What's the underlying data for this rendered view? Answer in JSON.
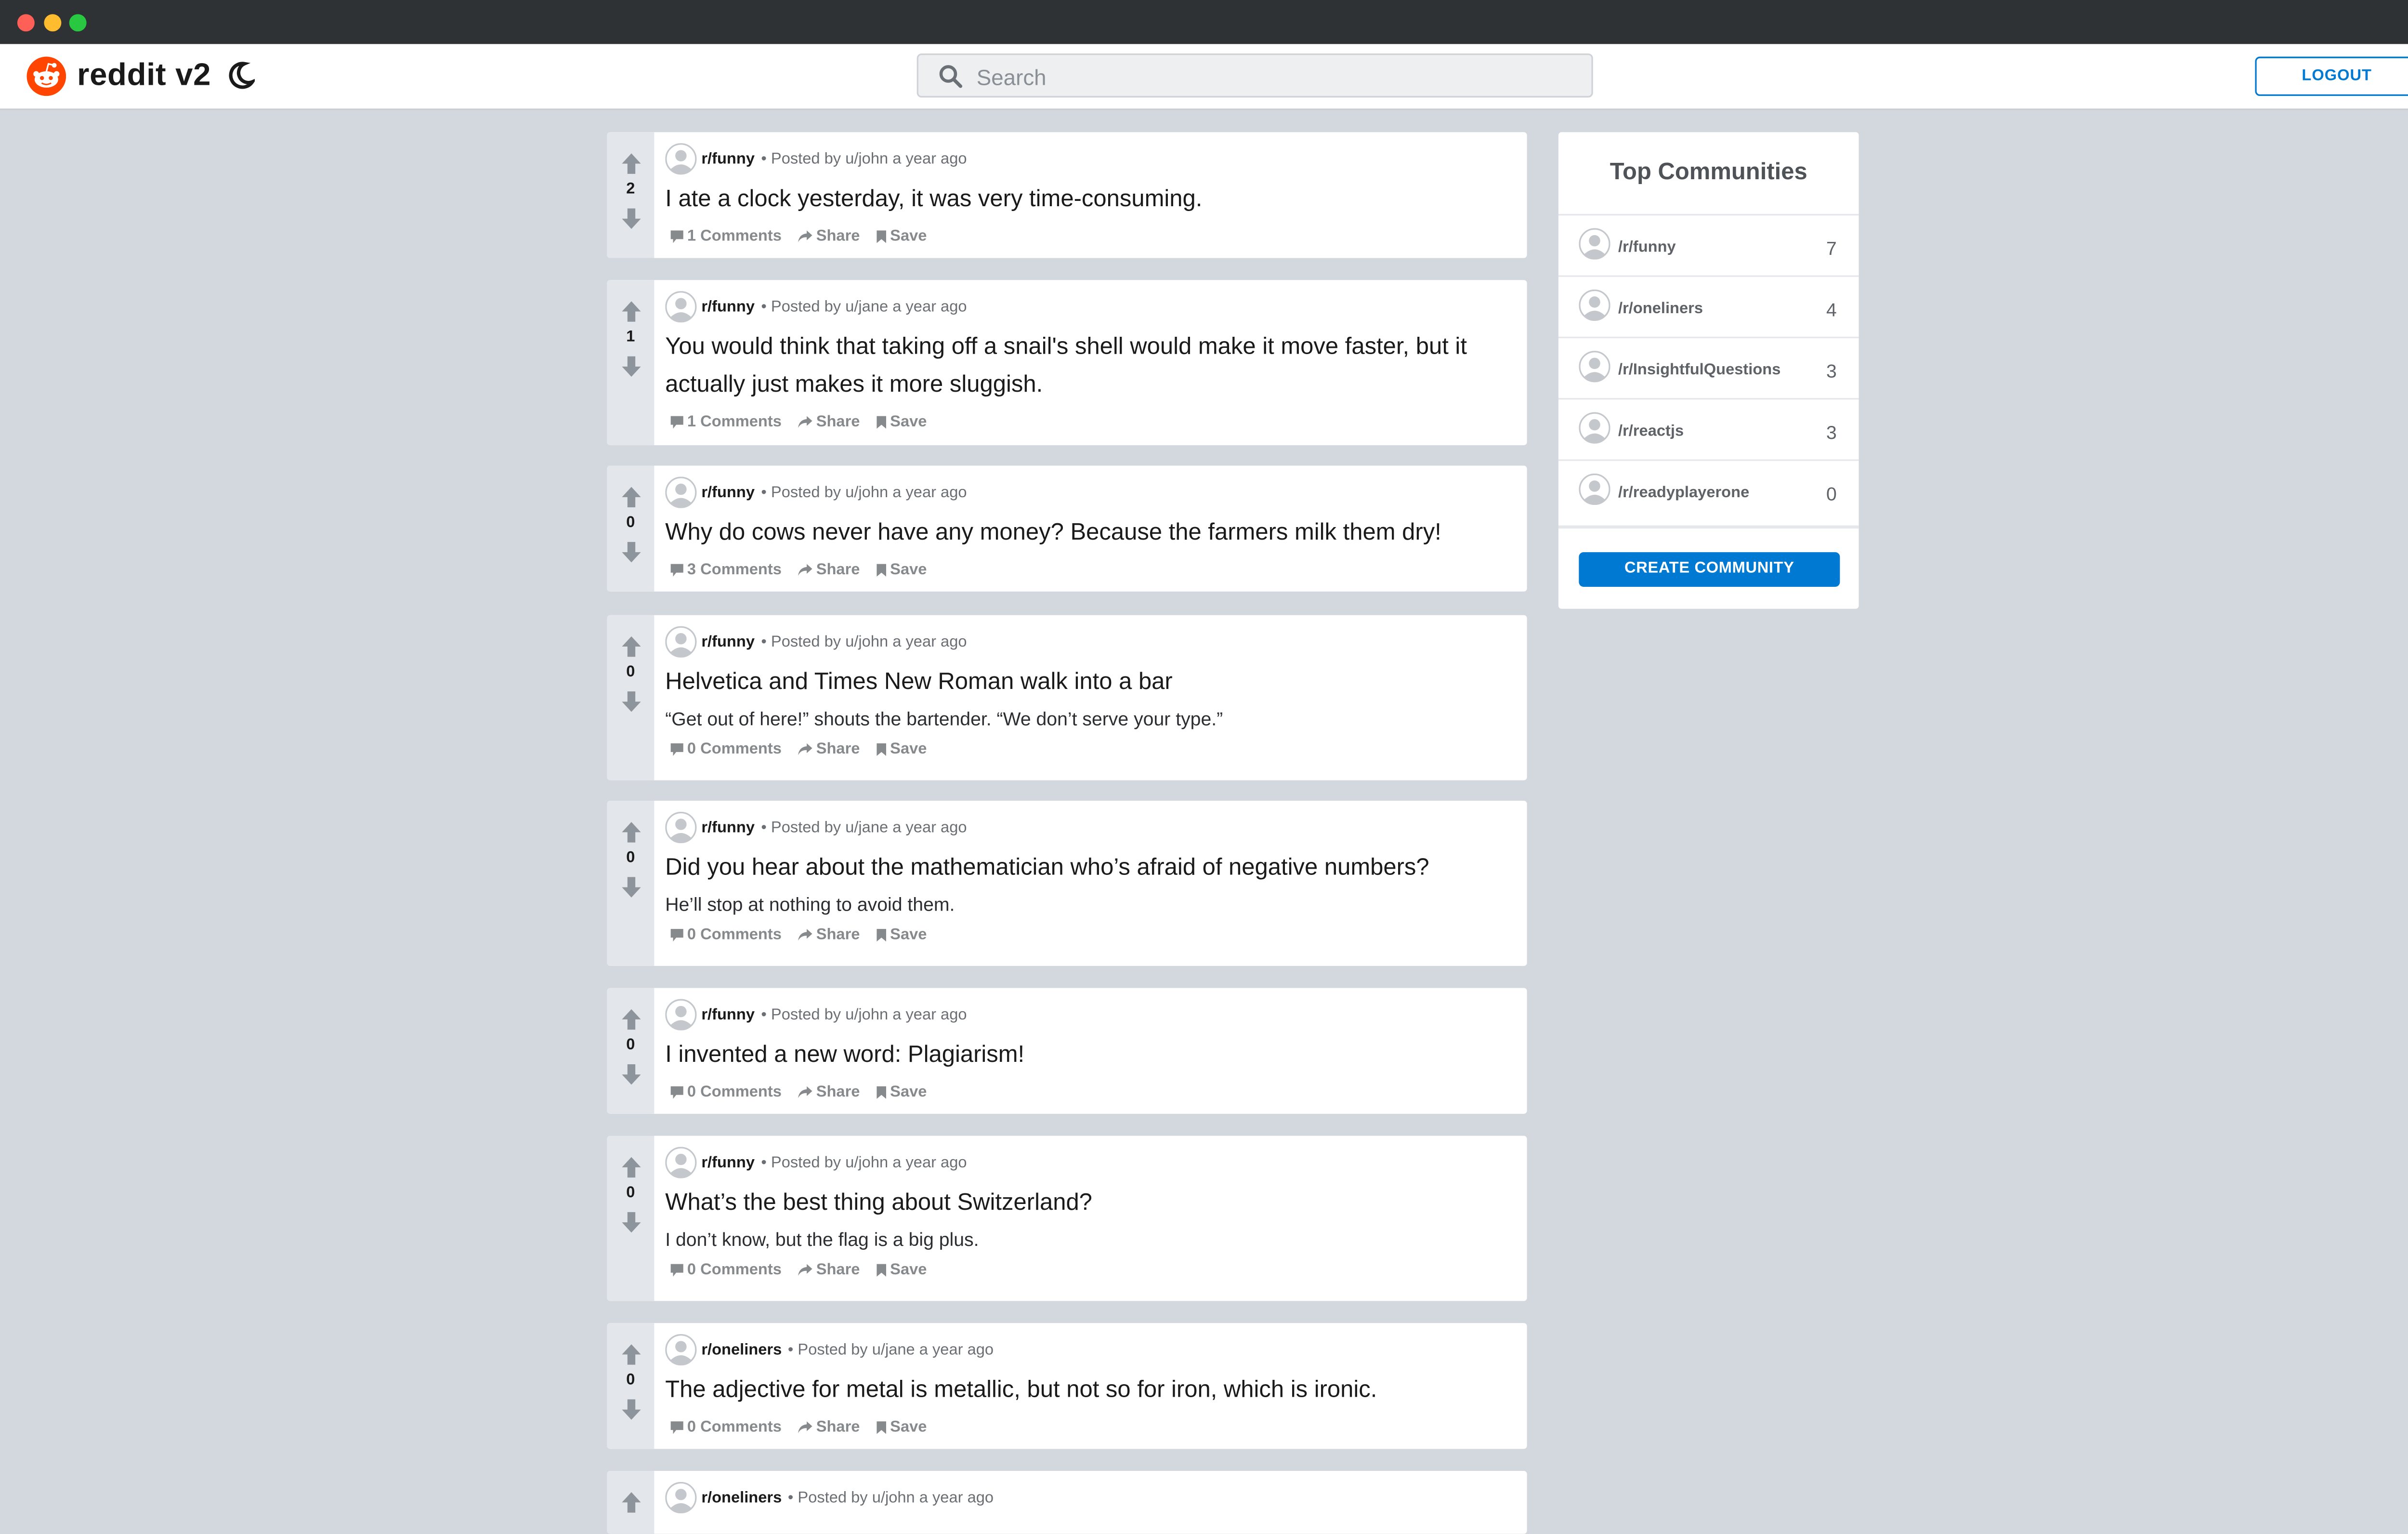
{
  "app": {
    "title": "reddit v2"
  },
  "header": {
    "search_placeholder": "Search",
    "logout_label": "LOGOUT"
  },
  "posts": [
    {
      "community": "r/funny",
      "author_text": "• Posted by u/john a year ago",
      "score": "2",
      "title": "I ate a clock yesterday, it was very time-consuming.",
      "body": "",
      "comments": "1 Comments",
      "share": "Share",
      "save": "Save"
    },
    {
      "community": "r/funny",
      "author_text": "• Posted by u/jane a year ago",
      "score": "1",
      "title": "You would think that taking off a snail's shell would make it move faster, but it actually just makes it more sluggish.",
      "body": "",
      "comments": "1 Comments",
      "share": "Share",
      "save": "Save"
    },
    {
      "community": "r/funny",
      "author_text": "• Posted by u/john a year ago",
      "score": "0",
      "title": "Why do cows never have any money? Because the farmers milk them dry!",
      "body": "",
      "comments": "3 Comments",
      "share": "Share",
      "save": "Save"
    },
    {
      "community": "r/funny",
      "author_text": "• Posted by u/john a year ago",
      "score": "0",
      "title": "Helvetica and Times New Roman walk into a bar",
      "body": "“Get out of here!” shouts the bartender. “We don’t serve your type.”",
      "comments": "0 Comments",
      "share": "Share",
      "save": "Save"
    },
    {
      "community": "r/funny",
      "author_text": "• Posted by u/jane a year ago",
      "score": "0",
      "title": "Did you hear about the mathematician who’s afraid of negative numbers?",
      "body": "He’ll stop at nothing to avoid them.",
      "comments": "0 Comments",
      "share": "Share",
      "save": "Save"
    },
    {
      "community": "r/funny",
      "author_text": "• Posted by u/john a year ago",
      "score": "0",
      "title": "I invented a new word: Plagiarism!",
      "body": "",
      "comments": "0 Comments",
      "share": "Share",
      "save": "Save"
    },
    {
      "community": "r/funny",
      "author_text": "• Posted by u/john a year ago",
      "score": "0",
      "title": "What’s the best thing about Switzerland?",
      "body": "I don’t know, but the flag is a big plus.",
      "comments": "0 Comments",
      "share": "Share",
      "save": "Save"
    },
    {
      "community": "r/oneliners",
      "author_text": "• Posted by u/jane a year ago",
      "score": "0",
      "title": "The adjective for metal is metallic, but not so for iron, which is ironic.",
      "body": "",
      "comments": "0 Comments",
      "share": "Share",
      "save": "Save"
    },
    {
      "community": "r/oneliners",
      "author_text": "• Posted by u/john a year ago",
      "score": "",
      "title": "",
      "body": "",
      "comments": "",
      "share": "",
      "save": ""
    }
  ],
  "sidebar": {
    "title": "Top Communities",
    "communities": [
      {
        "name": "/r/funny",
        "count": "7"
      },
      {
        "name": "/r/oneliners",
        "count": "4"
      },
      {
        "name": "/r/InsightfulQuestions",
        "count": "3"
      },
      {
        "name": "/r/reactjs",
        "count": "3"
      },
      {
        "name": "/r/readyplayerone",
        "count": "0"
      }
    ],
    "create_label": "CREATE COMMUNITY"
  },
  "colors": {
    "accent": "#0079d3",
    "brand": "#ff4500",
    "background": "#d3d7de"
  },
  "icons": [
    "reddit-logo-icon",
    "moon-icon",
    "search-icon",
    "upvote-arrow-icon",
    "downvote-arrow-icon",
    "comment-icon",
    "share-icon",
    "bookmark-icon",
    "user-avatar-icon"
  ]
}
